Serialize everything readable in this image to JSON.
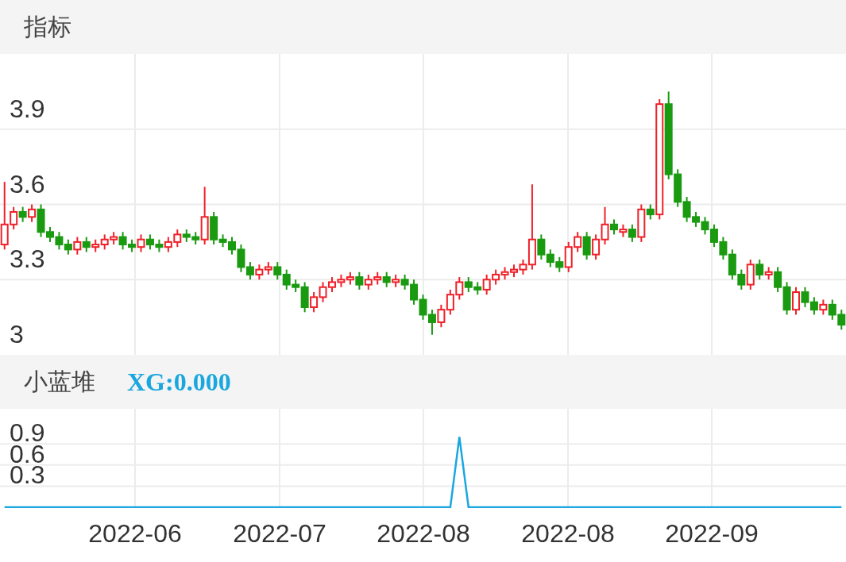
{
  "price_panel": {
    "title": "指标",
    "chart_data": {
      "type": "candlestick",
      "grid": true,
      "ylim": [
        3.0,
        4.2
      ],
      "yticks": [
        {
          "value": 3.9,
          "label": "3.9"
        },
        {
          "value": 3.6,
          "label": "3.6"
        },
        {
          "value": 3.3,
          "label": "3.3"
        },
        {
          "value": 3.0,
          "label": "3"
        }
      ],
      "ohlc": [
        [
          3.44,
          3.69,
          3.42,
          3.52
        ],
        [
          3.52,
          3.59,
          3.5,
          3.57
        ],
        [
          3.57,
          3.59,
          3.53,
          3.55
        ],
        [
          3.55,
          3.6,
          3.53,
          3.58
        ],
        [
          3.58,
          3.6,
          3.47,
          3.49
        ],
        [
          3.49,
          3.51,
          3.45,
          3.47
        ],
        [
          3.47,
          3.49,
          3.42,
          3.44
        ],
        [
          3.44,
          3.46,
          3.4,
          3.42
        ],
        [
          3.42,
          3.47,
          3.4,
          3.45
        ],
        [
          3.45,
          3.47,
          3.41,
          3.43
        ],
        [
          3.43,
          3.46,
          3.41,
          3.44
        ],
        [
          3.44,
          3.48,
          3.42,
          3.46
        ],
        [
          3.46,
          3.49,
          3.44,
          3.47
        ],
        [
          3.47,
          3.49,
          3.42,
          3.44
        ],
        [
          3.44,
          3.46,
          3.41,
          3.43
        ],
        [
          3.43,
          3.48,
          3.41,
          3.46
        ],
        [
          3.46,
          3.48,
          3.42,
          3.44
        ],
        [
          3.44,
          3.46,
          3.41,
          3.43
        ],
        [
          3.43,
          3.47,
          3.41,
          3.45
        ],
        [
          3.45,
          3.5,
          3.43,
          3.48
        ],
        [
          3.48,
          3.5,
          3.45,
          3.47
        ],
        [
          3.47,
          3.49,
          3.44,
          3.46
        ],
        [
          3.46,
          3.67,
          3.44,
          3.55
        ],
        [
          3.55,
          3.57,
          3.44,
          3.46
        ],
        [
          3.46,
          3.48,
          3.43,
          3.45
        ],
        [
          3.45,
          3.47,
          3.4,
          3.42
        ],
        [
          3.42,
          3.44,
          3.33,
          3.35
        ],
        [
          3.35,
          3.37,
          3.3,
          3.32
        ],
        [
          3.32,
          3.36,
          3.3,
          3.34
        ],
        [
          3.34,
          3.37,
          3.32,
          3.35
        ],
        [
          3.35,
          3.37,
          3.3,
          3.32
        ],
        [
          3.32,
          3.34,
          3.26,
          3.28
        ],
        [
          3.28,
          3.3,
          3.25,
          3.27
        ],
        [
          3.27,
          3.29,
          3.17,
          3.19
        ],
        [
          3.19,
          3.25,
          3.17,
          3.23
        ],
        [
          3.23,
          3.29,
          3.21,
          3.27
        ],
        [
          3.27,
          3.31,
          3.25,
          3.29
        ],
        [
          3.29,
          3.32,
          3.27,
          3.3
        ],
        [
          3.3,
          3.33,
          3.28,
          3.31
        ],
        [
          3.31,
          3.33,
          3.26,
          3.28
        ],
        [
          3.28,
          3.32,
          3.26,
          3.3
        ],
        [
          3.3,
          3.33,
          3.28,
          3.31
        ],
        [
          3.31,
          3.33,
          3.27,
          3.29
        ],
        [
          3.29,
          3.32,
          3.27,
          3.3
        ],
        [
          3.3,
          3.32,
          3.26,
          3.28
        ],
        [
          3.28,
          3.3,
          3.2,
          3.22
        ],
        [
          3.22,
          3.24,
          3.14,
          3.16
        ],
        [
          3.16,
          3.18,
          3.08,
          3.13
        ],
        [
          3.13,
          3.2,
          3.11,
          3.18
        ],
        [
          3.18,
          3.26,
          3.16,
          3.24
        ],
        [
          3.24,
          3.31,
          3.22,
          3.29
        ],
        [
          3.29,
          3.31,
          3.25,
          3.27
        ],
        [
          3.27,
          3.29,
          3.24,
          3.26
        ],
        [
          3.26,
          3.32,
          3.24,
          3.3
        ],
        [
          3.3,
          3.34,
          3.28,
          3.32
        ],
        [
          3.32,
          3.35,
          3.3,
          3.33
        ],
        [
          3.33,
          3.36,
          3.31,
          3.34
        ],
        [
          3.34,
          3.38,
          3.32,
          3.36
        ],
        [
          3.36,
          3.68,
          3.34,
          3.46
        ],
        [
          3.46,
          3.48,
          3.38,
          3.4
        ],
        [
          3.4,
          3.42,
          3.35,
          3.37
        ],
        [
          3.37,
          3.39,
          3.33,
          3.35
        ],
        [
          3.35,
          3.45,
          3.33,
          3.43
        ],
        [
          3.43,
          3.49,
          3.41,
          3.47
        ],
        [
          3.47,
          3.49,
          3.38,
          3.4
        ],
        [
          3.4,
          3.48,
          3.38,
          3.46
        ],
        [
          3.46,
          3.59,
          3.44,
          3.52
        ],
        [
          3.52,
          3.54,
          3.48,
          3.5
        ],
        [
          3.49,
          3.52,
          3.47,
          3.5
        ],
        [
          3.5,
          3.52,
          3.45,
          3.47
        ],
        [
          3.47,
          3.6,
          3.45,
          3.58
        ],
        [
          3.58,
          3.6,
          3.54,
          3.56
        ],
        [
          3.56,
          4.02,
          3.54,
          4.0
        ],
        [
          4.0,
          4.05,
          3.7,
          3.72
        ],
        [
          3.72,
          3.74,
          3.59,
          3.61
        ],
        [
          3.61,
          3.63,
          3.53,
          3.55
        ],
        [
          3.55,
          3.57,
          3.51,
          3.53
        ],
        [
          3.53,
          3.55,
          3.48,
          3.5
        ],
        [
          3.5,
          3.52,
          3.43,
          3.45
        ],
        [
          3.45,
          3.47,
          3.38,
          3.4
        ],
        [
          3.4,
          3.42,
          3.3,
          3.32
        ],
        [
          3.32,
          3.34,
          3.26,
          3.28
        ],
        [
          3.28,
          3.38,
          3.26,
          3.36
        ],
        [
          3.36,
          3.38,
          3.3,
          3.32
        ],
        [
          3.32,
          3.35,
          3.3,
          3.33
        ],
        [
          3.33,
          3.35,
          3.25,
          3.27
        ],
        [
          3.27,
          3.29,
          3.16,
          3.18
        ],
        [
          3.18,
          3.27,
          3.16,
          3.25
        ],
        [
          3.25,
          3.27,
          3.19,
          3.21
        ],
        [
          3.21,
          3.23,
          3.16,
          3.18
        ],
        [
          3.18,
          3.22,
          3.16,
          3.2
        ],
        [
          3.2,
          3.22,
          3.14,
          3.16
        ],
        [
          3.16,
          3.18,
          3.1,
          3.12
        ]
      ]
    }
  },
  "indicator_panel": {
    "title": "小蓝堆",
    "value_label": "XG:0.000",
    "chart_data": {
      "type": "line",
      "grid": true,
      "ylim": [
        0,
        1.4
      ],
      "yticks": [
        0.3,
        0.6,
        0.9
      ],
      "series": [
        {
          "color": "#1aa7e0",
          "values": [
            0,
            0,
            0,
            0,
            0,
            0,
            0,
            0,
            0,
            0,
            0,
            0,
            0,
            0,
            0,
            0,
            0,
            0,
            0,
            0,
            0,
            0,
            0,
            0,
            0,
            0,
            0,
            0,
            0,
            0,
            0,
            0,
            0,
            0,
            0,
            0,
            0,
            0,
            0,
            0,
            0,
            0,
            0,
            0,
            0,
            0,
            0,
            0,
            0,
            0,
            1,
            0,
            0,
            0,
            0,
            0,
            0,
            0,
            0,
            0,
            0,
            0,
            0,
            0,
            0,
            0,
            0,
            0,
            0,
            0,
            0,
            0,
            0,
            0,
            0,
            0,
            0,
            0,
            0,
            0,
            0,
            0,
            0,
            0,
            0,
            0,
            0,
            0,
            0,
            0,
            0,
            0,
            0
          ]
        }
      ]
    }
  },
  "x_axis_labels": [
    "2022-06",
    "2022-07",
    "2022-08",
    "2022-08",
    "2022-09"
  ]
}
